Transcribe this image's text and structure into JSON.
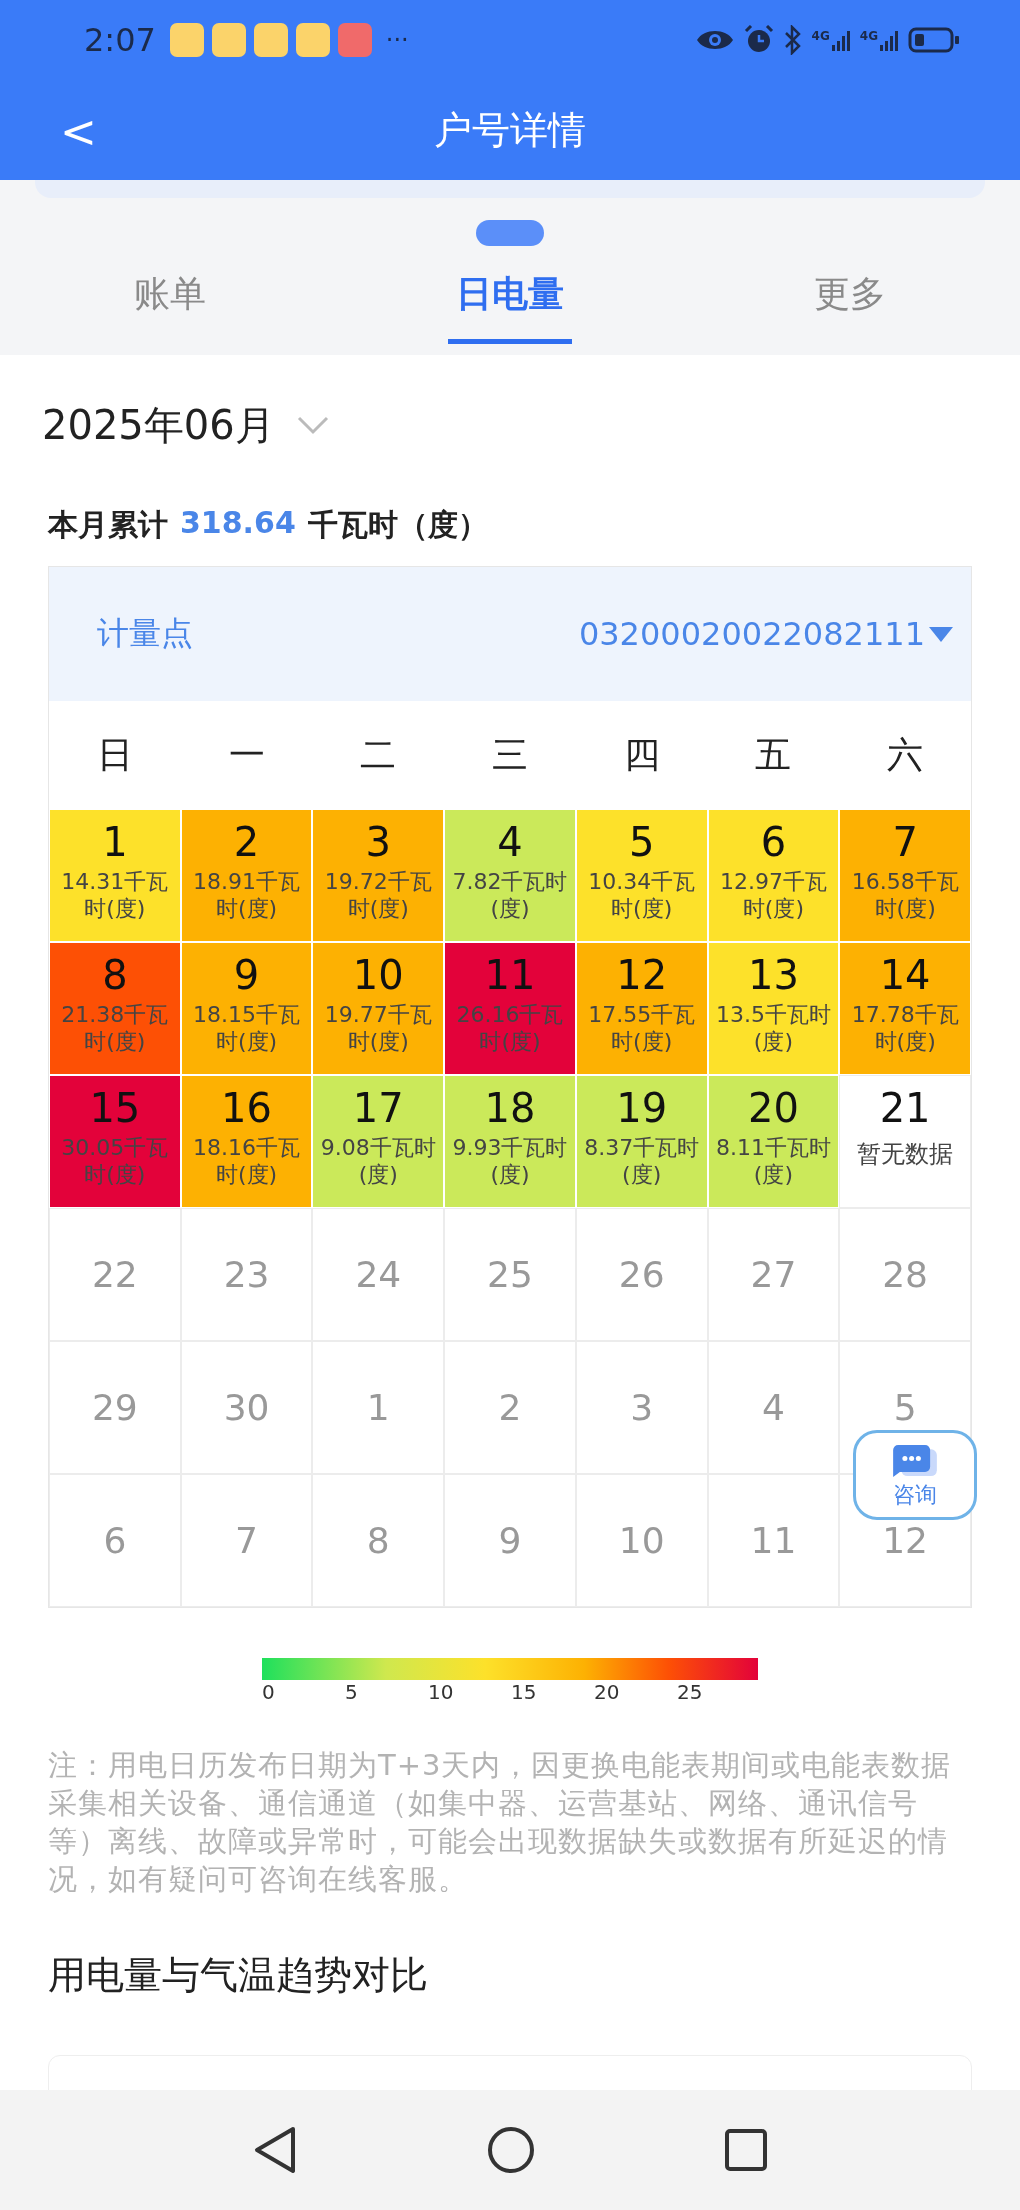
{
  "status_bar": {
    "time": "2:07",
    "more": "···",
    "network": [
      "4G",
      "4G"
    ]
  },
  "header": {
    "back": "<",
    "title": "户号详情"
  },
  "tabs": [
    {
      "label": "账单",
      "selected": false
    },
    {
      "label": "日电量",
      "selected": true
    },
    {
      "label": "更多",
      "selected": false
    }
  ],
  "month": "2025年06月",
  "summary": {
    "label": "本月累计",
    "value": "318.64",
    "unit": "千瓦时（度）"
  },
  "meter": {
    "label": "计量点",
    "value": "03200020022082111"
  },
  "weekdays": [
    "日",
    "一",
    "二",
    "三",
    "四",
    "五",
    "六"
  ],
  "days": [
    {
      "kind": "reading",
      "day": "1",
      "value": "14.31千瓦时(度)",
      "color": "#fde12a"
    },
    {
      "kind": "reading",
      "day": "2",
      "value": "18.91千瓦时(度)",
      "color": "#fdb102"
    },
    {
      "kind": "reading",
      "day": "3",
      "value": "19.72千瓦时(度)",
      "color": "#fdb102"
    },
    {
      "kind": "reading",
      "day": "4",
      "value": "7.82千瓦时(度)",
      "color": "#cbe95a"
    },
    {
      "kind": "reading",
      "day": "5",
      "value": "10.34千瓦时(度)",
      "color": "#fde12a"
    },
    {
      "kind": "reading",
      "day": "6",
      "value": "12.97千瓦时(度)",
      "color": "#fde12a"
    },
    {
      "kind": "reading",
      "day": "7",
      "value": "16.58千瓦时(度)",
      "color": "#fdb102"
    },
    {
      "kind": "reading",
      "day": "8",
      "value": "21.38千瓦时(度)",
      "color": "#fd5005"
    },
    {
      "kind": "reading",
      "day": "9",
      "value": "18.15千瓦时(度)",
      "color": "#fdb102"
    },
    {
      "kind": "reading",
      "day": "10",
      "value": "19.77千瓦时(度)",
      "color": "#fdb102"
    },
    {
      "kind": "reading",
      "day": "11",
      "value": "26.16千瓦时(度)",
      "color": "#e3023a"
    },
    {
      "kind": "reading",
      "day": "12",
      "value": "17.55千瓦时(度)",
      "color": "#fdb102"
    },
    {
      "kind": "reading",
      "day": "13",
      "value": "13.5千瓦时(度)",
      "color": "#fde12a"
    },
    {
      "kind": "reading",
      "day": "14",
      "value": "17.78千瓦时(度)",
      "color": "#fdb102"
    },
    {
      "kind": "reading",
      "day": "15",
      "value": "30.05千瓦时(度)",
      "color": "#e3023a"
    },
    {
      "kind": "reading",
      "day": "16",
      "value": "18.16千瓦时(度)",
      "color": "#fdb102"
    },
    {
      "kind": "reading",
      "day": "17",
      "value": "9.08千瓦时(度)",
      "color": "#cbe95a"
    },
    {
      "kind": "reading",
      "day": "18",
      "value": "9.93千瓦时(度)",
      "color": "#cbe95a"
    },
    {
      "kind": "reading",
      "day": "19",
      "value": "8.37千瓦时(度)",
      "color": "#cbe95a"
    },
    {
      "kind": "reading",
      "day": "20",
      "value": "8.11千瓦时(度)",
      "color": "#cbe95a"
    },
    {
      "kind": "no_data",
      "day": "21",
      "value": "暂无数据"
    },
    {
      "kind": "muted",
      "day": "22"
    },
    {
      "kind": "muted",
      "day": "23"
    },
    {
      "kind": "muted",
      "day": "24"
    },
    {
      "kind": "muted",
      "day": "25"
    },
    {
      "kind": "muted",
      "day": "26"
    },
    {
      "kind": "muted",
      "day": "27"
    },
    {
      "kind": "muted",
      "day": "28"
    },
    {
      "kind": "muted",
      "day": "29"
    },
    {
      "kind": "muted",
      "day": "30"
    },
    {
      "kind": "muted",
      "day": "1"
    },
    {
      "kind": "muted",
      "day": "2"
    },
    {
      "kind": "muted",
      "day": "3"
    },
    {
      "kind": "muted",
      "day": "4"
    },
    {
      "kind": "muted",
      "day": "5"
    },
    {
      "kind": "muted",
      "day": "6"
    },
    {
      "kind": "muted",
      "day": "7"
    },
    {
      "kind": "muted",
      "day": "8"
    },
    {
      "kind": "muted",
      "day": "9"
    },
    {
      "kind": "muted",
      "day": "10"
    },
    {
      "kind": "muted",
      "day": "11"
    },
    {
      "kind": "muted",
      "day": "12"
    }
  ],
  "legend": {
    "ticks": [
      "0",
      "5",
      "10",
      "15",
      "20",
      "25"
    ]
  },
  "note": "注：用电日历发布日期为T+3天内，因更换电能表期间或电能表数据采集相关设备、通信通道（如集中器、运营基站、网络、通讯信号等）离线、故障或异常时，可能会出现数据缺失或数据有所延迟的情况，如有疑问可咨询在线客服。",
  "section_title": "用电量与气温趋势对比",
  "consult_button": {
    "label": "咨询"
  }
}
